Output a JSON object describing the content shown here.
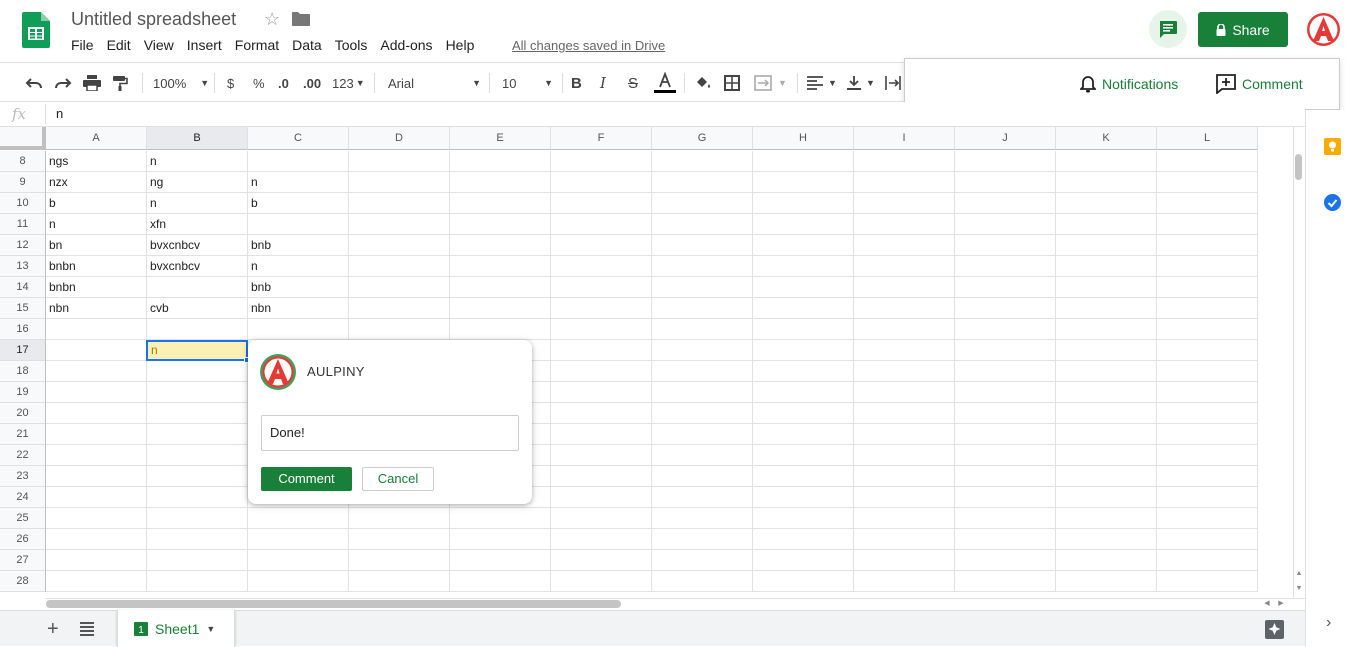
{
  "header": {
    "title": "Untitled spreadsheet",
    "save_status": "All changes saved in Drive",
    "share_label": "Share",
    "menu": [
      "File",
      "Edit",
      "View",
      "Insert",
      "Format",
      "Data",
      "Tools",
      "Add-ons",
      "Help"
    ]
  },
  "toolbar": {
    "zoom": "100%",
    "currency": "$",
    "percent": "%",
    "dec_decrease": ".0",
    "dec_increase": ".00",
    "more_formats": "123",
    "font": "Arial",
    "font_size": "10"
  },
  "notifications_panel": {
    "notifications_label": "Notifications",
    "comment_label": "Comment"
  },
  "formula_bar": {
    "fx": "fx",
    "value": "n"
  },
  "grid": {
    "columns": [
      "A",
      "B",
      "C",
      "D",
      "E",
      "F",
      "G",
      "H",
      "I",
      "J",
      "K",
      "L"
    ],
    "selected_column": "B",
    "selected_row": "17",
    "rows": [
      {
        "num": "8",
        "cells": [
          "ngs",
          "n",
          ""
        ]
      },
      {
        "num": "9",
        "cells": [
          "nzx",
          "ng",
          "n"
        ]
      },
      {
        "num": "10",
        "cells": [
          "b",
          "n",
          "b"
        ]
      },
      {
        "num": "11",
        "cells": [
          "n",
          "xfn",
          ""
        ]
      },
      {
        "num": "12",
        "cells": [
          "bn",
          "bvxcnbcv",
          "bnb"
        ]
      },
      {
        "num": "13",
        "cells": [
          "bnbn",
          "bvxcnbcv",
          "n"
        ]
      },
      {
        "num": "14",
        "cells": [
          "bnbn",
          "",
          "bnb"
        ]
      },
      {
        "num": "15",
        "cells": [
          "nbn",
          "cvb",
          "nbn"
        ]
      },
      {
        "num": "16",
        "cells": [
          "",
          "",
          ""
        ]
      },
      {
        "num": "17",
        "cells": [
          "",
          "n",
          ""
        ]
      },
      {
        "num": "18",
        "cells": [
          "",
          "",
          ""
        ]
      },
      {
        "num": "19",
        "cells": [
          "",
          "",
          ""
        ]
      },
      {
        "num": "20",
        "cells": [
          "",
          "",
          ""
        ]
      },
      {
        "num": "21",
        "cells": [
          "",
          "",
          ""
        ]
      },
      {
        "num": "22",
        "cells": [
          "",
          "",
          ""
        ]
      },
      {
        "num": "23",
        "cells": [
          "",
          "",
          ""
        ]
      },
      {
        "num": "24",
        "cells": [
          "",
          "",
          ""
        ]
      },
      {
        "num": "25",
        "cells": [
          "",
          "",
          ""
        ]
      },
      {
        "num": "26",
        "cells": [
          "",
          "",
          ""
        ]
      },
      {
        "num": "27",
        "cells": [
          "",
          "",
          ""
        ]
      },
      {
        "num": "28",
        "cells": [
          "",
          "",
          ""
        ]
      }
    ],
    "active_cell_value": "n"
  },
  "comment_popup": {
    "author": "AULPINY",
    "input_value": "Done!",
    "submit_label": "Comment",
    "cancel_label": "Cancel"
  },
  "sheets": {
    "tabs": [
      {
        "label": "Sheet1"
      }
    ]
  },
  "colors": {
    "brand_green": "#188038",
    "active_cell_fill": "#fdf0b5",
    "selection_blue": "#1a73e8",
    "avatar_red": "#e53935"
  }
}
